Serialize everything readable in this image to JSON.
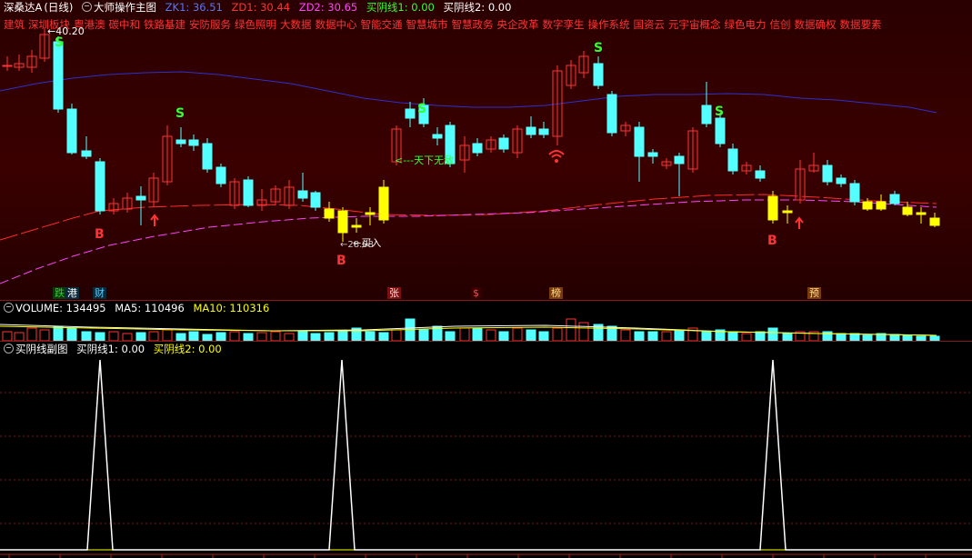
{
  "main_header": {
    "stock_name": "深桑达A",
    "period": "(日线)",
    "indicator_name": "大师操作主图",
    "zk": "ZK1: 36.51",
    "zd1": "ZD1: 30.44",
    "zd2": "ZD2: 30.65",
    "line1": "买阴线1: 0.00",
    "line2": "买阴线2: 0.00"
  },
  "sectors": [
    "建筑",
    "深圳板块",
    "粤港澳",
    "碳中和",
    "铁路基建",
    "安防服务",
    "绿色照明",
    "大数据",
    "数据中心",
    "智能交通",
    "智慧城市",
    "智慧政务",
    "央企改革",
    "数字孪生",
    "操作系统",
    "国资云",
    "元宇宙概念",
    "绿色电力",
    "信创",
    "数据确权",
    "数据要素"
  ],
  "annotations": {
    "high_price": "←40.20",
    "tianxia": "<---天下无敌",
    "buy": "←买入",
    "low_price": "←28.08"
  },
  "signals": {
    "s": "S",
    "b": "B"
  },
  "event_tags": [
    {
      "text": "跌",
      "color": "#33cc33",
      "bg": "#0a3a0a"
    },
    {
      "text": "港",
      "color": "#ffffff",
      "bg": "#0a2a3a"
    },
    {
      "text": "财",
      "color": "#55ccff",
      "bg": "#0a2a3a"
    },
    {
      "text": "张",
      "color": "#ffdddd",
      "bg": "#7a1010"
    },
    {
      "text": "$",
      "color": "#ff4444",
      "bg": "#3a0000"
    },
    {
      "text": "榜",
      "color": "#ffdd88",
      "bg": "#7a3a10"
    },
    {
      "text": "预",
      "color": "#ffdd88",
      "bg": "#7a3a10"
    }
  ],
  "volume_header": {
    "volume": "VOLUME: 134495",
    "ma5": "MA5: 110496",
    "ma10": "MA10: 110316"
  },
  "sub_header": {
    "name": "买阴线副图",
    "line1": "买阴线1: 0.00",
    "line2": "买阴线2: 0.00"
  },
  "colors": {
    "up": "#ff3333",
    "down": "#54ffff",
    "signal_yellow": "#ffff00",
    "ma_red": "#ff2a2a",
    "ma_magenta": "#ff44ff",
    "ma_blue": "#3030cc",
    "text_yellow": "#ffff00",
    "text_magenta": "#ff44ff",
    "text_blue": "#5577ff"
  },
  "icons": [
    "collapse-icon",
    "wifi-signal-icon",
    "up-arrow-icon"
  ]
}
